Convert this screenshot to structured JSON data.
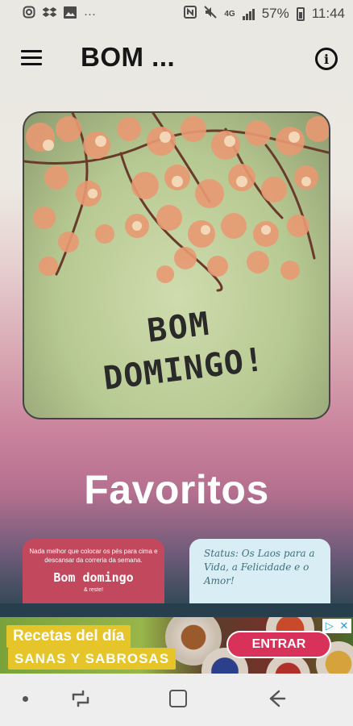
{
  "status_bar": {
    "left_icons": [
      "instagram-icon",
      "dropbox-icon",
      "gallery-icon",
      "more-notifications-icon"
    ],
    "more_text": "···",
    "right_icons": [
      "nfc-icon",
      "mute-icon",
      "4g-icon",
      "signal-icon",
      "battery-icon"
    ],
    "network_label": "4G",
    "battery": "57%",
    "time": "11:44"
  },
  "app_bar": {
    "title": "BOM ...",
    "menu_icon": "hamburger-menu-icon",
    "info_icon": "info-icon",
    "info_glyph": "i"
  },
  "hero": {
    "line1": "BOM",
    "line2": "DOMINGO!"
  },
  "favorites": {
    "title": "Favoritos",
    "cards": [
      {
        "small_text": "Nada melhor que colocar os pés para cima e descansar da correria da semana.",
        "big_text": "Bom domingo",
        "tiny_text": "& reste!"
      },
      {
        "script_text": "Status: Os Laos para a Vida, a Felicidade e o Amor!"
      }
    ]
  },
  "ad": {
    "headline": "Recetas del día",
    "subline": "SANAS Y SABROSAS",
    "cta": "ENTRAR",
    "adchoices_icon": "adchoices-icon",
    "close_icon": "close-icon",
    "adchoices_glyph": "▷",
    "close_glyph": "✕"
  },
  "nav_bar": {
    "icons": [
      "home-dot-icon",
      "recent-apps-icon",
      "home-square-icon",
      "back-arrow-icon"
    ]
  }
}
